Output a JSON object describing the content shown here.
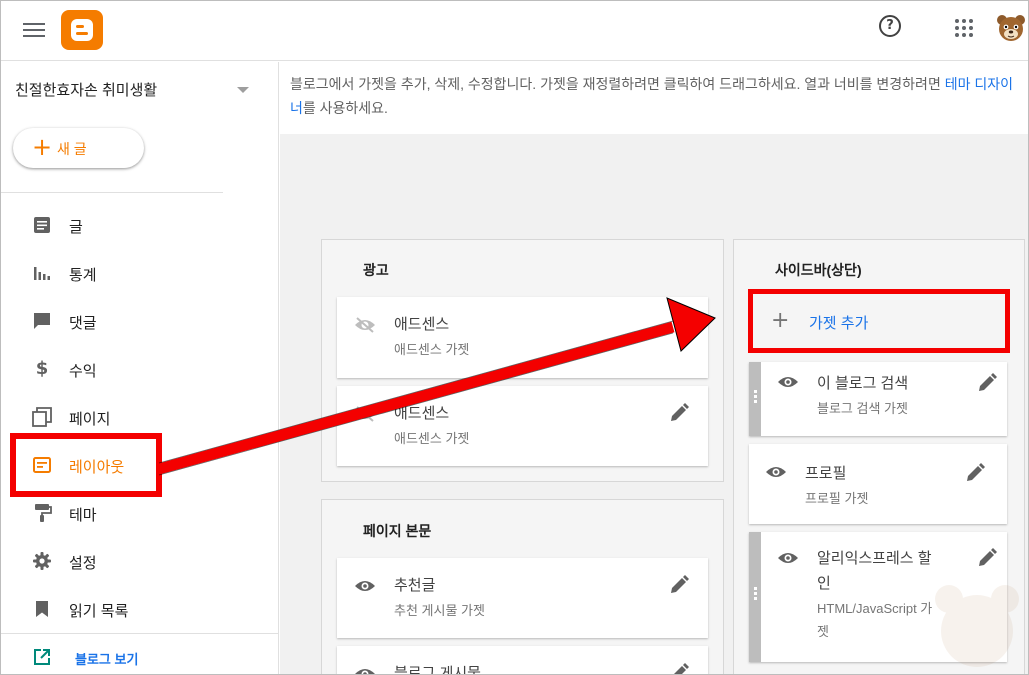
{
  "topbar": {
    "menu_icon": "hamburger-menu-icon",
    "logo_icon": "blogger-logo-icon",
    "help_glyph": "?",
    "apps_icon": "google-apps-grid-icon",
    "avatar_icon": "bear-avatar"
  },
  "sidebar": {
    "blog_name": "친절한효자손 취미생활",
    "new_post": {
      "plus": "+",
      "label": "새 글"
    },
    "items": [
      {
        "label": "글",
        "icon": "posts-icon"
      },
      {
        "label": "통계",
        "icon": "stats-icon"
      },
      {
        "label": "댓글",
        "icon": "comments-icon"
      },
      {
        "label": "수익",
        "icon": "dollar-icon",
        "glyph": "$"
      },
      {
        "label": "페이지",
        "icon": "pages-icon"
      },
      {
        "label": "레이아웃",
        "icon": "layout-icon",
        "active": true
      },
      {
        "label": "테마",
        "icon": "theme-roller-icon"
      },
      {
        "label": "설정",
        "icon": "gear-icon"
      },
      {
        "label": "읽기 목록",
        "icon": "bookmark-icon"
      }
    ],
    "view_blog": "블로그 보기"
  },
  "main": {
    "description_part1": "블로그에서 가젯을 추가, 삭제, 수정합니다. 가젯을 재정렬하려면 클릭하여 드래그하세요. 열과 너비를 변경하려면 ",
    "description_link": "테마 디자이너",
    "description_part2": "를 사용하세요.",
    "sections": {
      "ads": {
        "title": "광고",
        "widgets": [
          {
            "name": "애드센스",
            "sub": "애드센스 가젯"
          },
          {
            "name": "애드센스",
            "sub": "애드센스 가젯"
          }
        ]
      },
      "page_body": {
        "title": "페이지 본문",
        "widgets": [
          {
            "name": "추천글",
            "sub": "추천 게시물 가젯"
          },
          {
            "name": "블로그 게시물",
            "sub": ""
          }
        ]
      },
      "sidebar_top": {
        "title": "사이드바(상단)",
        "add_gadget": {
          "plus": "+",
          "label": "가젯 추가"
        },
        "widgets": [
          {
            "name": "이 블로그 검색",
            "sub": "블로그 검색 가젯"
          },
          {
            "name": "프로필",
            "sub": "프로필 가젯"
          },
          {
            "name": "알리익스프레스 할",
            "name2": "인",
            "sub": "HTML/JavaScript 가",
            "sub2": "젯"
          }
        ]
      }
    }
  },
  "colors": {
    "accent": "#f57c00",
    "link": "#1a73e8",
    "annotation_red": "#f40000"
  }
}
